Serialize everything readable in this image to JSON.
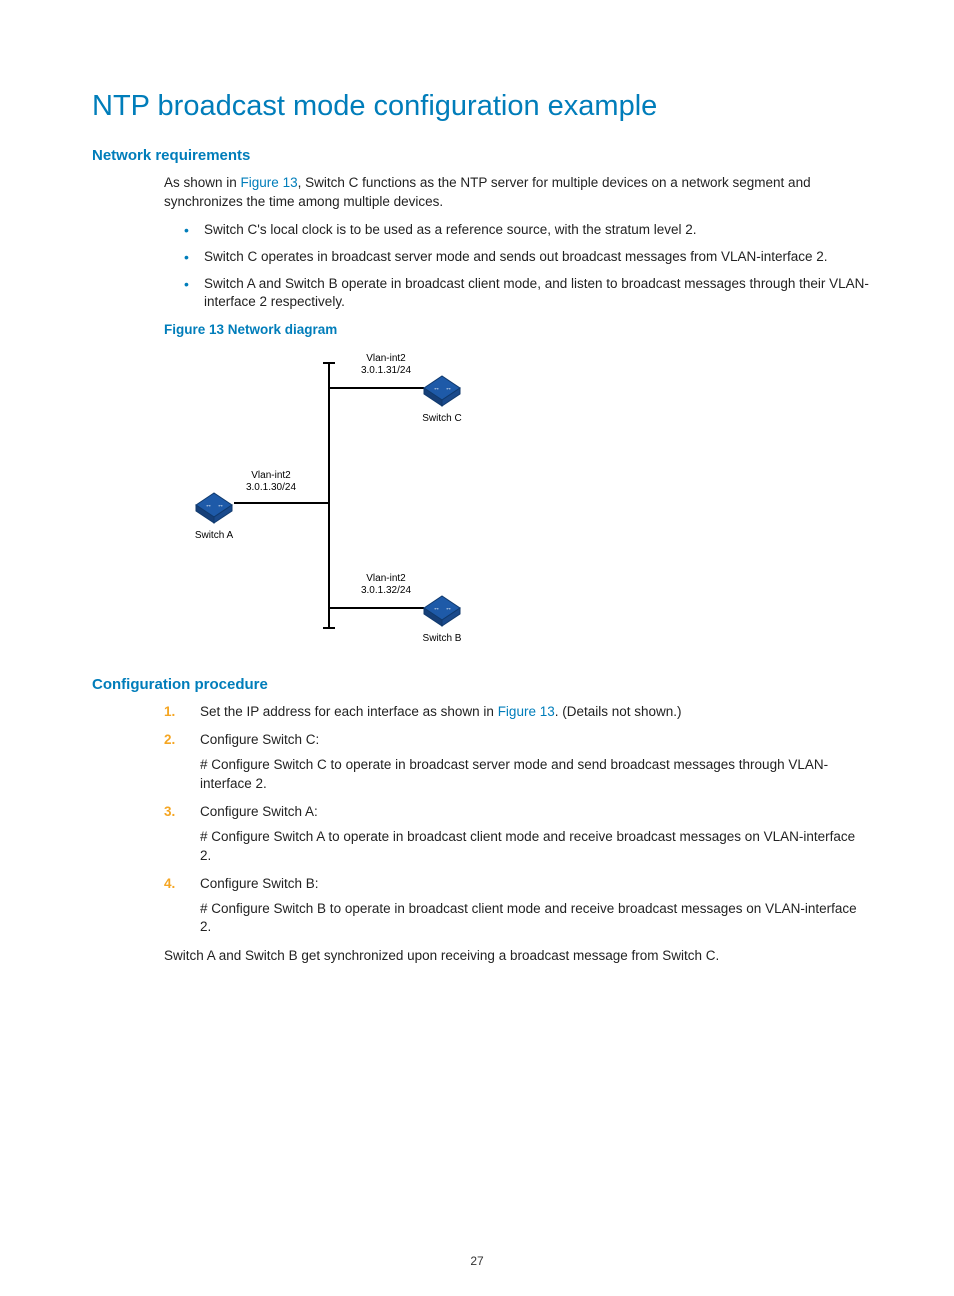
{
  "title": "NTP broadcast mode configuration example",
  "section_net_req": {
    "heading": "Network requirements",
    "intro_a": "As shown in ",
    "intro_link": "Figure 13",
    "intro_b": ", Switch C functions as the NTP server for multiple devices on a network segment and synchronizes the time among multiple devices.",
    "bullets": [
      "Switch C's local clock is to be used as a reference source, with the stratum level 2.",
      "Switch C operates in broadcast server mode and sends out broadcast messages from VLAN-interface 2.",
      "Switch A and Switch B operate in broadcast client mode, and listen to broadcast messages through their VLAN-interface 2 respectively."
    ]
  },
  "figure": {
    "caption": "Figure 13 Network diagram",
    "switch_c": {
      "label": "Switch C",
      "if": "Vlan-int2",
      "ip": "3.0.1.31/24"
    },
    "switch_a": {
      "label": "Switch A",
      "if": "Vlan-int2",
      "ip": "3.0.1.30/24"
    },
    "switch_b": {
      "label": "Switch B",
      "if": "Vlan-int2",
      "ip": "3.0.1.32/24"
    }
  },
  "section_config": {
    "heading": "Configuration procedure",
    "steps": [
      {
        "text_a": "Set the IP address for each interface as shown in ",
        "link": "Figure 13",
        "text_b": ". (Details not shown.)"
      },
      {
        "text_a": "Configure Switch C:",
        "sub": "# Configure Switch C to operate in broadcast server mode and send broadcast messages through VLAN-interface 2."
      },
      {
        "text_a": "Configure Switch A:",
        "sub": "# Configure Switch A to operate in broadcast client mode and receive broadcast messages on VLAN-interface 2."
      },
      {
        "text_a": "Configure Switch B:",
        "sub": "# Configure Switch B to operate in broadcast client mode and receive broadcast messages on VLAN-interface 2."
      }
    ],
    "closing": "Switch A and Switch B get synchronized upon receiving a broadcast message from Switch C."
  },
  "page_number": "27"
}
